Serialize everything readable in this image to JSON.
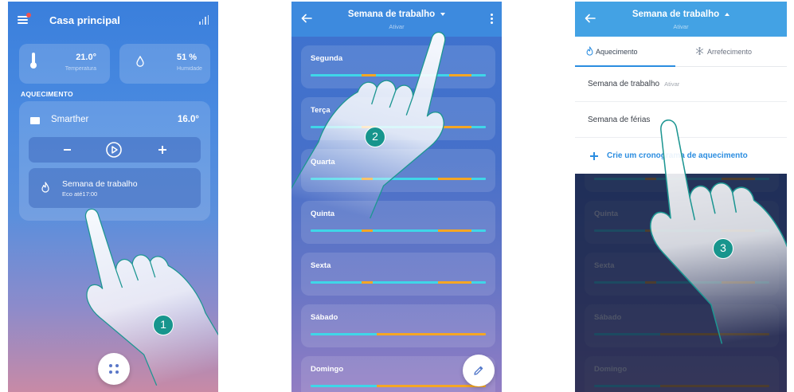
{
  "colors": {
    "eco": "#3fd6e8",
    "comfort": "#f5a623",
    "link": "#2b8de0",
    "badge": "#17958d"
  },
  "screen1": {
    "menu_icon": "menu-icon",
    "title": "Casa principal",
    "stats_icon": "bar-chart-icon",
    "temperature": {
      "icon": "thermometer-icon",
      "value": "21.0°",
      "label": "Temperatura"
    },
    "humidity": {
      "icon": "drop-icon",
      "value": "51 %",
      "label": "Humidade"
    },
    "section": "AQUECIMENTO",
    "thermostat": {
      "icon": "thermostat-icon",
      "name": "Smarther",
      "setpoint": "16.0°",
      "minus_icon": "minus-icon",
      "mode_icon": "play-circle-icon",
      "plus_icon": "plus-icon",
      "program_icon": "flame-icon",
      "program": "Semana de trabalho",
      "status": "Eco até17:00"
    },
    "fab_icon": "dots-icon",
    "step": "1"
  },
  "screen2": {
    "back_icon": "arrow-left-icon",
    "title": "Semana de trabalho",
    "subtitle": "Ativar",
    "more_icon": "more-vertical-icon",
    "days": [
      {
        "name": "Segunda",
        "comfort_hours": [
          [
            7,
            9
          ],
          [
            19,
            22
          ]
        ]
      },
      {
        "name": "Terça",
        "comfort_hours": [
          [
            7,
            9
          ],
          [
            18,
            22
          ]
        ]
      },
      {
        "name": "Quarta",
        "comfort_hours": [
          [
            7,
            8.5
          ],
          [
            17.5,
            22
          ]
        ]
      },
      {
        "name": "Quinta",
        "comfort_hours": [
          [
            7,
            8.5
          ],
          [
            17.5,
            22
          ]
        ]
      },
      {
        "name": "Sexta",
        "comfort_hours": [
          [
            7,
            8.5
          ],
          [
            17.5,
            22
          ]
        ]
      },
      {
        "name": "Sábado",
        "comfort_hours": [
          [
            9,
            24
          ]
        ]
      },
      {
        "name": "Domingo",
        "comfort_hours": [
          [
            9,
            24
          ]
        ]
      }
    ],
    "fab_icon": "pencil-icon",
    "step": "2"
  },
  "screen3": {
    "back_icon": "arrow-left-icon",
    "title": "Semana de trabalho",
    "subtitle": "Ativar",
    "tabs": [
      {
        "label": "Aquecimento",
        "icon": "flame-icon",
        "active": true
      },
      {
        "label": "Arrefecimento",
        "icon": "snowflake-icon",
        "active": false
      }
    ],
    "programs": [
      {
        "name": "Semana de trabalho",
        "status": "Ativar"
      },
      {
        "name": "Semana de férias"
      }
    ],
    "create": {
      "icon": "plus-icon",
      "label": "Crie um cronograma de aquecimento"
    },
    "step": "3"
  }
}
